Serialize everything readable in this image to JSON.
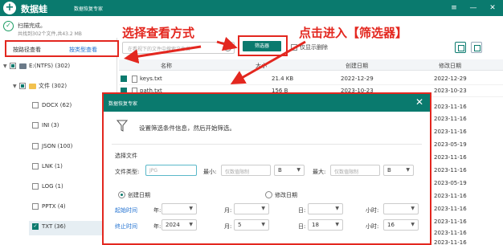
{
  "app": {
    "logo_glyph": "+",
    "name": "数据蛙",
    "subtitle": "数据恢复专家",
    "brand_color": "#0a7a6e"
  },
  "window_controls": [
    "≡",
    "—",
    "✕"
  ],
  "scan": {
    "status": "扫描完成。",
    "detail": "共找到302个文件,共43.2 MB"
  },
  "sidebar": {
    "tab_path": "按路径查看",
    "tab_type": "按类型查看",
    "tree": [
      {
        "label": "E:(NTFS) (302)",
        "kind": "drive",
        "state": "partial",
        "indent": 0
      },
      {
        "label": "文件 (302)",
        "kind": "folder",
        "state": "partial",
        "indent": 1
      },
      {
        "label": "DOCX (62)",
        "kind": "type",
        "state": "none",
        "indent": 2
      },
      {
        "label": "INI (3)",
        "kind": "type",
        "state": "none",
        "indent": 2
      },
      {
        "label": "JSON (100)",
        "kind": "type",
        "state": "none",
        "indent": 2
      },
      {
        "label": "LNK (1)",
        "kind": "type",
        "state": "none",
        "indent": 2
      },
      {
        "label": "LOG (1)",
        "kind": "type",
        "state": "none",
        "indent": 2
      },
      {
        "label": "PPTX (4)",
        "kind": "type",
        "state": "none",
        "indent": 2
      },
      {
        "label": "TXT (36)",
        "kind": "type",
        "state": "checked",
        "indent": 2
      }
    ]
  },
  "toolbar": {
    "search_placeholder": "在看视下的文件中搜索文件名",
    "filter_button": "筛选器",
    "only_deleted": "仅显示删除"
  },
  "list": {
    "columns": {
      "name": "名称",
      "size": "大小",
      "created": "创建日期",
      "modified": "修改日期"
    },
    "rows": [
      {
        "name": "keys.txt",
        "size": "21.4 KB",
        "created": "2022-12-29",
        "modified": "2022-12-29"
      },
      {
        "name": "path.txt",
        "size": "156 B",
        "created": "2023-10-23",
        "modified": "2023-10-23"
      }
    ],
    "right_dates": [
      "2023-11-16",
      "2023-11-16",
      "2023-11-16",
      "2023-05-19",
      "2023-11-16",
      "2023-11-16",
      "2023-05-19",
      "2023-11-16",
      "2023-11-16",
      "2023-11-16",
      "2023-11-16",
      "2023-11-16"
    ]
  },
  "annotations": {
    "left": "选择查看方式",
    "right": "点击进入【筛选器】"
  },
  "dialog": {
    "title": "数据恢复专家",
    "close": "✕",
    "description": "设置筛选条件信息，然后开始筛选。",
    "section_label": "选择文件",
    "type_label": "文件类型:",
    "type_placeholder": "JPG",
    "min_label": "最小:",
    "min_placeholder": "仅数值限制",
    "min_unit": "B",
    "max_label": "最大:",
    "max_placeholder": "仅数值限制",
    "max_unit": "B",
    "radio_created": "创建日期",
    "radio_modified": "修改日期",
    "start_label": "起始时间",
    "end_label": "终止时间",
    "year_label": "年:",
    "month_label": "月:",
    "day_label": "日:",
    "hour_label": "小时:",
    "start": {
      "year": "",
      "month": "",
      "day": "",
      "hour": ""
    },
    "end": {
      "year": "2024",
      "month": "5",
      "day": "18",
      "hour": "16"
    }
  }
}
